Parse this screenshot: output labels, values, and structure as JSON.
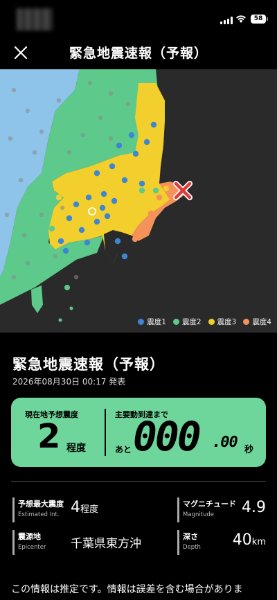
{
  "status_bar": {
    "battery": "58"
  },
  "header": {
    "title": "緊急地震速報（予報）"
  },
  "legend": [
    {
      "label": "震度1",
      "color": "#3e86d4"
    },
    {
      "label": "震度2",
      "color": "#5dc98a"
    },
    {
      "label": "震度3",
      "color": "#f2cf2c"
    },
    {
      "label": "震度4",
      "color": "#f4925a"
    }
  ],
  "info": {
    "title": "緊急地震速報（予報）",
    "timestamp": "2026年08月30日 00:17 発表",
    "current_location_label": "現在地予想震度",
    "current_intensity_value": "2",
    "current_intensity_unit": "程度",
    "arrival_label": "主要動到達まで",
    "arrival_prefix": "あと",
    "arrival_seconds_big": "000",
    "arrival_seconds_small": ".00",
    "arrival_unit": "秒",
    "max_intensity_label": "予想最大震度",
    "max_intensity_sub": "Estimated Int.",
    "max_intensity_value": "4",
    "max_intensity_unit": "程度",
    "magnitude_label": "マグニチュード",
    "magnitude_sub": "Magnitude",
    "magnitude_value": "4.9",
    "epicenter_label": "震源地",
    "epicenter_sub": "Epicenter",
    "epicenter_value": "千葉県東方沖",
    "depth_label": "深さ",
    "depth_sub": "Depth",
    "depth_value": "40",
    "depth_unit": "km",
    "note": "この情報は推定です。情報は誤差を含む場合がありま"
  }
}
